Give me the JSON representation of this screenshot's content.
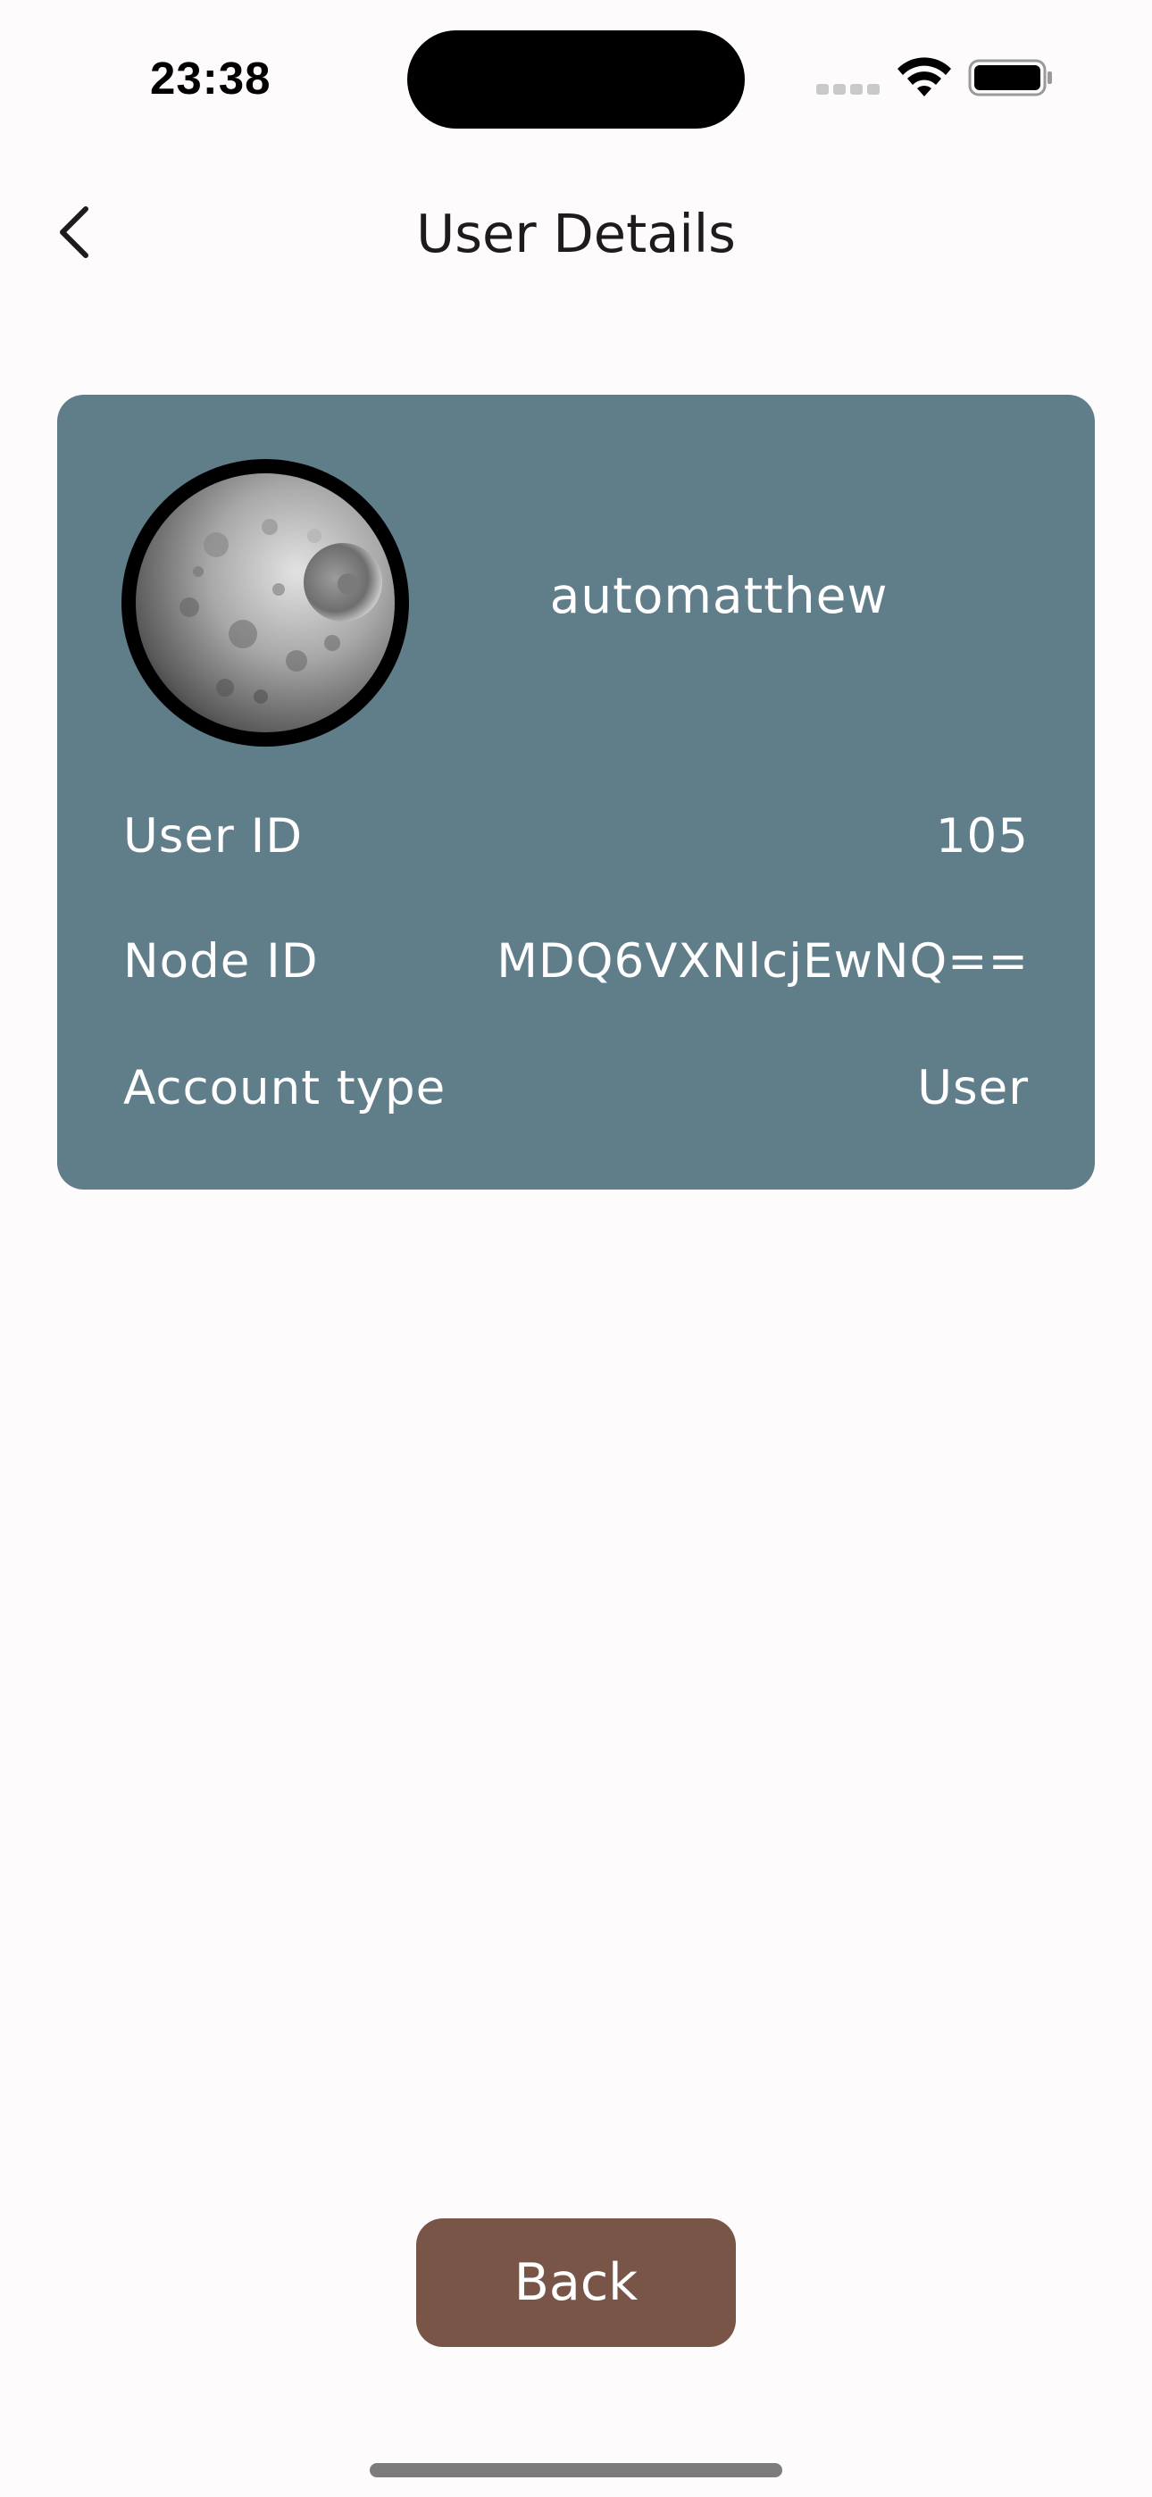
{
  "status_bar": {
    "time": "23:38"
  },
  "app_bar": {
    "title": "User Details",
    "back_icon": "chevron-left-icon"
  },
  "user_card": {
    "background_color": "#607d8a",
    "avatar_icon": "moon-avatar-image",
    "username": "automatthew",
    "details": [
      {
        "label": "User ID",
        "value": "105"
      },
      {
        "label": "Node ID",
        "value": "MDQ6VXNlcjEwNQ=="
      },
      {
        "label": "Account type",
        "value": "User"
      }
    ]
  },
  "footer": {
    "back_button_label": "Back",
    "back_button_color": "#795548"
  }
}
